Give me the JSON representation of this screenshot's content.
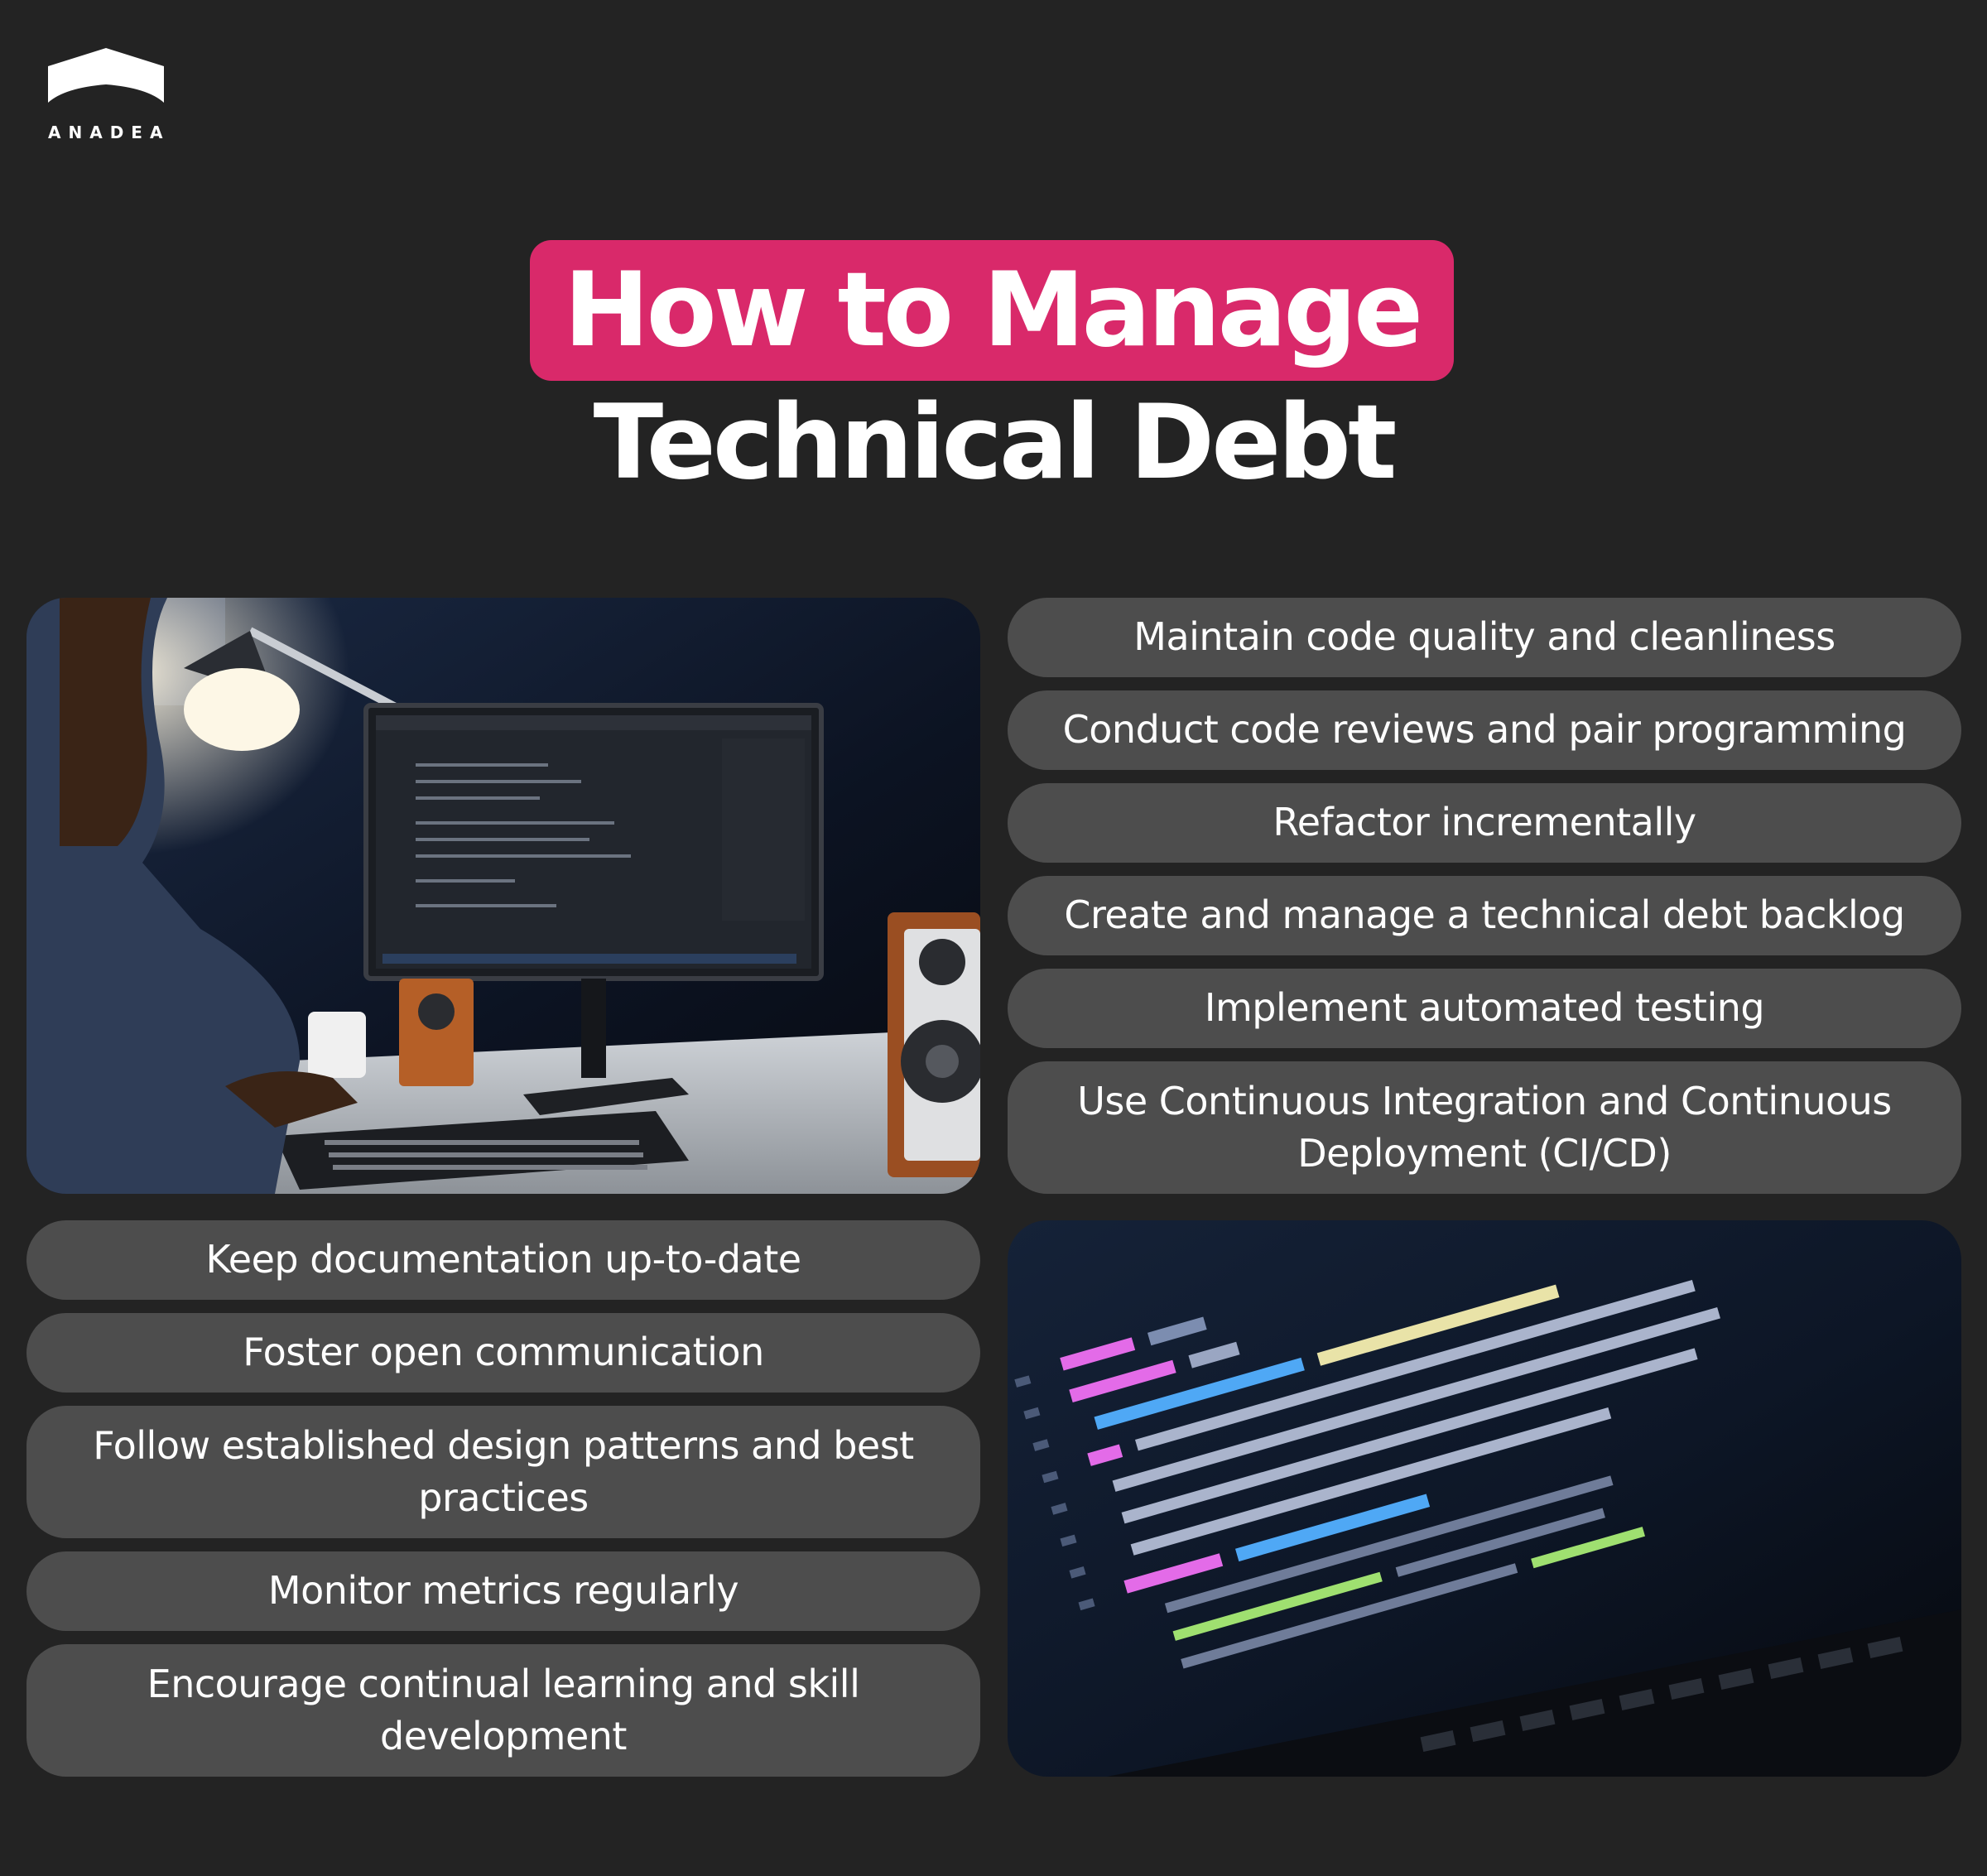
{
  "brand": {
    "name": "ANADEA",
    "logo_icon": "house-roof-logo-icon"
  },
  "title": {
    "highlight": "How to Manage",
    "line2": "Technical Debt"
  },
  "colors": {
    "background": "#232323",
    "accent": "#d9296a",
    "pill": "#4d4d4d",
    "text": "#ffffff"
  },
  "right_items": [
    "Maintain code quality and cleanliness",
    "Conduct code reviews and pair programming",
    "Refactor incrementally",
    "Create and manage a technical debt backlog",
    "Implement automated testing",
    "Use Continuous Integration and Continuous Deployment (CI/CD)"
  ],
  "left_items": [
    "Keep documentation up-to-date",
    "Foster open communication",
    "Follow established design patterns and best practices",
    "Monitor metrics regularly",
    "Encourage continual learning and skill development"
  ],
  "images": {
    "top_left": "developer-at-desk-photo",
    "bottom_right": "code-on-laptop-screen-photo"
  }
}
